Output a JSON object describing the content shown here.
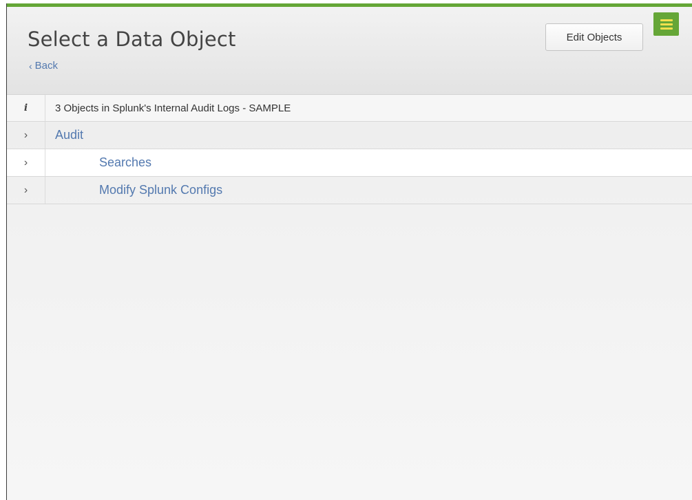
{
  "header": {
    "title": "Select a Data Object",
    "back_label": "Back",
    "edit_objects_label": "Edit Objects"
  },
  "info": {
    "icon": "i",
    "text": "3 Objects in Splunk's Internal Audit Logs - SAMPLE"
  },
  "objects": [
    {
      "label": "Audit",
      "expand_icon": ">"
    },
    {
      "label": "Searches",
      "expand_icon": ">"
    },
    {
      "label": "Modify Splunk Configs",
      "expand_icon": ">"
    }
  ],
  "colors": {
    "accent_green": "#65a637",
    "link_blue": "#5379af",
    "menu_bars": "#f4e04d"
  },
  "icons": {
    "back": "chevron-left-icon",
    "menu": "hamburger-menu-icon",
    "info": "info-icon",
    "expand": "chevron-right-icon"
  }
}
